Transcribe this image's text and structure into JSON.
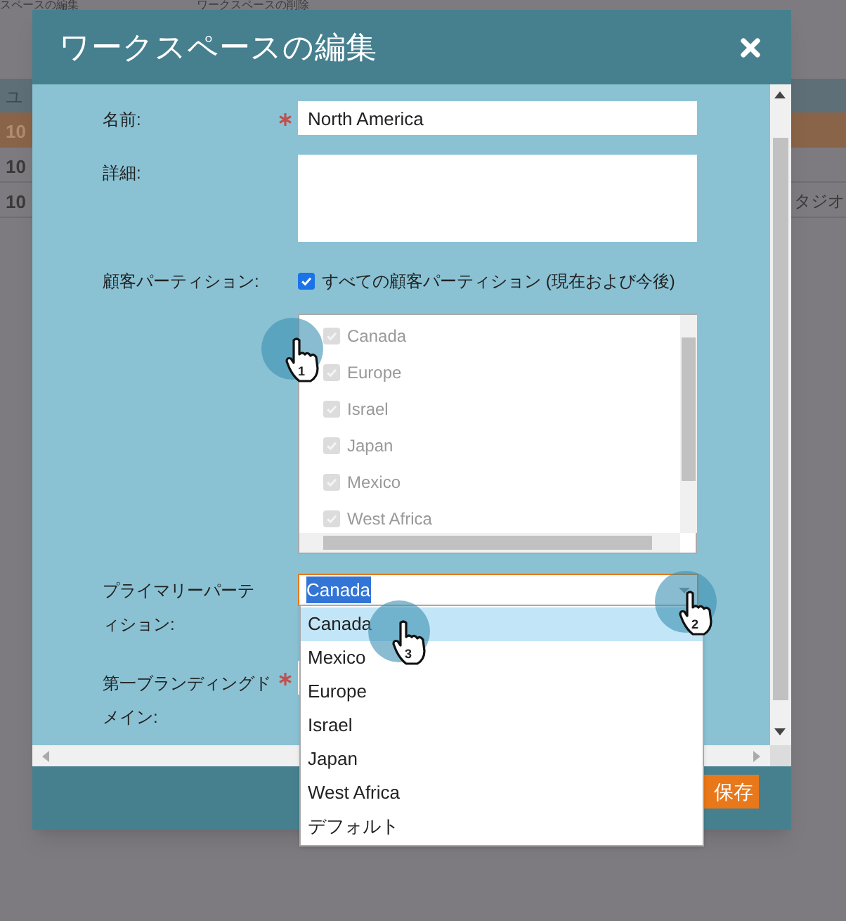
{
  "background": {
    "toolbar": [
      {
        "label": "スペースの編集"
      },
      {
        "label": "ワークスペースの削除"
      }
    ],
    "table": {
      "header": "ユ",
      "rows": [
        {
          "cell": "10",
          "selected": true
        },
        {
          "cell": "10",
          "selected": false
        },
        {
          "cell": "10",
          "selected": false,
          "extra": "タジオ"
        }
      ]
    }
  },
  "dialog": {
    "title": "ワークスペースの編集",
    "save_button": "保存",
    "fields": [
      {
        "kind": "text",
        "label": "名前:",
        "required": true,
        "value": "North America"
      },
      {
        "kind": "textarea",
        "label": "詳細:"
      },
      {
        "kind": "checkbox",
        "label": "顧客パーティション:",
        "checked": true,
        "text": "すべての顧客パーティション (現在および今後)"
      },
      {
        "kind": "checklist",
        "items": [
          {
            "label": "Canada",
            "checked": true,
            "disabled": true
          },
          {
            "label": "Europe",
            "checked": true,
            "disabled": true
          },
          {
            "label": "Israel",
            "checked": true,
            "disabled": true
          },
          {
            "label": "Japan",
            "checked": true,
            "disabled": true
          },
          {
            "label": "Mexico",
            "checked": true,
            "disabled": true
          },
          {
            "label": "West Africa",
            "checked": true,
            "disabled": true
          }
        ]
      },
      {
        "kind": "select",
        "label": "プライマリーパーティション:",
        "value": "Canada",
        "open": true
      },
      {
        "kind": "text",
        "label": "第一ブランディングドメイン:",
        "required": true
      }
    ]
  },
  "dropdown": {
    "options": [
      {
        "label": "Canada",
        "selected": true
      },
      {
        "label": "Mexico",
        "selected": false
      },
      {
        "label": "Europe",
        "selected": false
      },
      {
        "label": "Israel",
        "selected": false
      },
      {
        "label": "Japan",
        "selected": false
      },
      {
        "label": "West Africa",
        "selected": false
      },
      {
        "label": "デフォルト",
        "selected": false
      }
    ]
  },
  "cursors": [
    {
      "step": "1"
    },
    {
      "step": "2"
    },
    {
      "step": "3"
    }
  ]
}
